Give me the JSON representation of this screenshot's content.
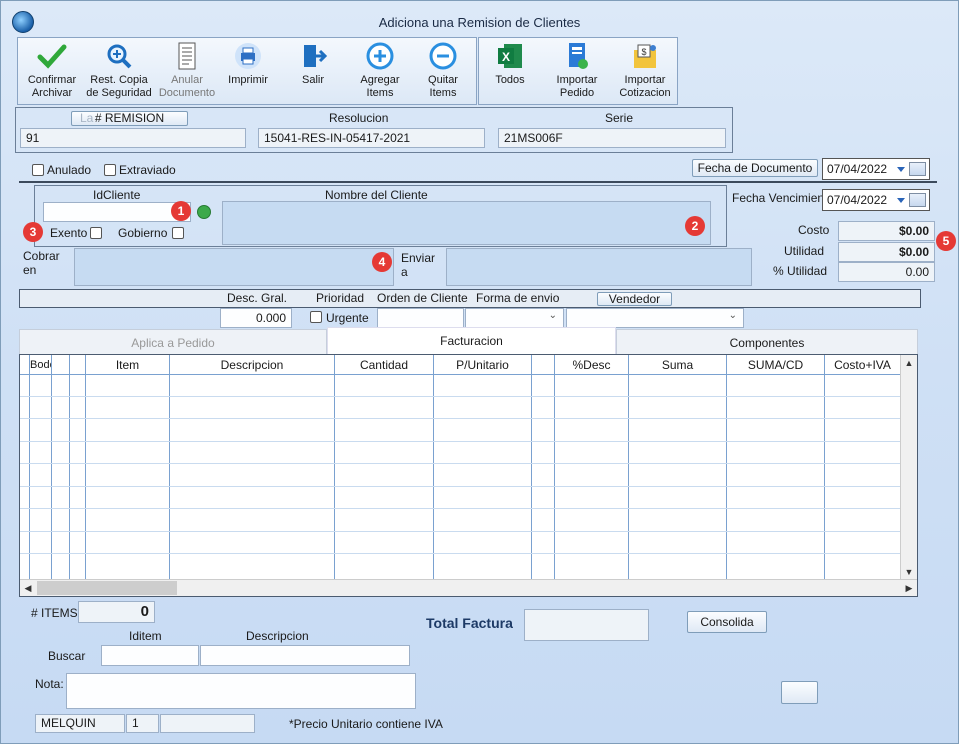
{
  "window": {
    "title": "Adiciona una Remision de Clientes"
  },
  "toolbar": {
    "confirmar": "Confirmar\nArchivar",
    "rest_copia": "Rest. Copia\nde Seguridad",
    "anular": "Anular\nDocumento",
    "imprimir": "Imprimir",
    "salir": "Salir",
    "agregar": "Agregar\nItems",
    "quitar": "Quitar\nItems",
    "todos": "Todos",
    "importar_pedido": "Importar\nPedido",
    "importar_cotizacion": "Importar\nCotizacion"
  },
  "header": {
    "remision_label": "# REMISION",
    "remision_hidden": "La",
    "remision_value": "91",
    "resolucion_label": "Resolucion",
    "resolucion_value": "15041-RES-IN-05417-2021",
    "serie_label": "Serie",
    "serie_value": "21MS006F"
  },
  "flags": {
    "anulado": "Anulado",
    "extraviado": "Extraviado"
  },
  "dates": {
    "fecha_doc_label": "Fecha de  Documento",
    "fecha_doc_value": "07/04/2022",
    "fecha_venc_label": "Fecha Vencimien",
    "fecha_venc_value": "07/04/2022"
  },
  "client": {
    "idcliente_label": "IdCliente",
    "idcliente_value": "",
    "nombre_label": "Nombre del Cliente",
    "exento": "Exento",
    "gobierno": "Gobierno",
    "cobrar_label": "Cobrar\nen",
    "enviar_label": "Enviar\na"
  },
  "badges": [
    "1",
    "2",
    "3",
    "4",
    "5"
  ],
  "costs": {
    "costo_label": "Costo",
    "costo_value": "$0.00",
    "utilidad_label": "Utilidad",
    "utilidad_value": "$0.00",
    "pct_label": "% Utilidad",
    "pct_value": "0.00"
  },
  "options": {
    "desc_label": "Desc. Gral.",
    "desc_value": "0.000",
    "prioridad_label": "Prioridad",
    "urgente": "Urgente",
    "orden_label": "Orden de Cliente",
    "forma_label": "Forma de envio",
    "vendedor_label": "Vendedor"
  },
  "tabs": [
    "Aplica a Pedido",
    "Facturacion",
    "Componentes"
  ],
  "grid": {
    "columns": [
      "Bodega",
      "",
      "",
      "Item",
      "Descripcion",
      "Cantidad",
      "P/Unitario",
      "",
      "%Desc",
      "Suma",
      "SUMA/CD",
      "Costo+IVA"
    ]
  },
  "footer": {
    "items_label": "# ITEMS",
    "items_value": "0",
    "total_label": "Total Factura",
    "total_value": "",
    "consolida": "Consolida",
    "iditem_label": "Iditem",
    "descripcion_label": "Descripcion",
    "buscar_label": "Buscar",
    "nota_label": "Nota:",
    "user": "MELQUIN",
    "user_num": "1",
    "note": "*Precio Unitario contiene IVA"
  }
}
